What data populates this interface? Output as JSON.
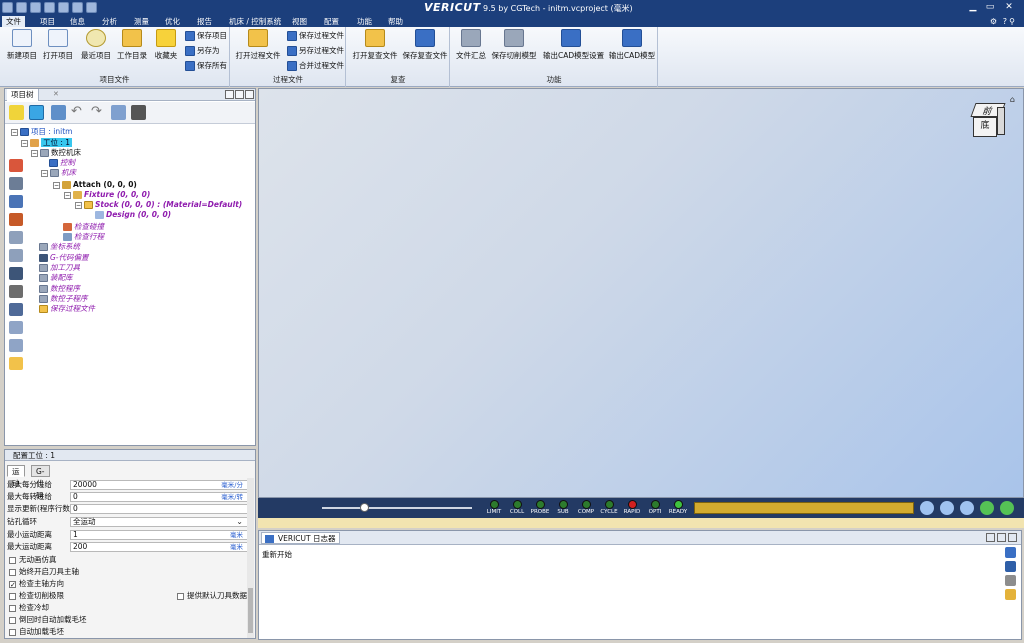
{
  "window": {
    "logo": "VERICUT",
    "title": "9.5 by CGTech - initm.vcproject (毫米)",
    "help": "?"
  },
  "menu": [
    "文件",
    "项目",
    "信息",
    "分析",
    "测量",
    "优化",
    "报告",
    "机床 / 控制系统",
    "视图",
    "配置",
    "功能",
    "帮助"
  ],
  "ribbon": {
    "project": {
      "label": "项目文件",
      "new": "新建项目",
      "open": "打开项目",
      "recent": "最近项目",
      "workdir": "工作目录",
      "fav": "收藏夹",
      "save": "保存项目",
      "saveas": "另存为",
      "saveall": "保存所有"
    },
    "process": {
      "label": "过程文件",
      "open": "打开过程文件",
      "save": "保存过程文件",
      "saveas": "另存过程文件",
      "merge": "合并过程文件"
    },
    "setting": {
      "label": "复查",
      "open": "打开复查文件",
      "save": "保存复查文件"
    },
    "function": {
      "label": "功能",
      "summary": "文件汇总",
      "savecut": "保存切削模型",
      "exportcadset": "输出CAD模型设置",
      "exportcad": "输出CAD模型"
    }
  },
  "tree_panel": {
    "tab": "项目树"
  },
  "tree": {
    "project": "项目 : initm",
    "setup": "工位 : 1",
    "machine": "数控机床",
    "control": "控制",
    "machine2": "机床",
    "attach": "Attach (0, 0, 0)",
    "fixture": "Fixture (0, 0, 0)",
    "stock": "Stock (0, 0, 0) : (Material=Default)",
    "design": "Design (0, 0, 0)",
    "collision": "检查碰撞",
    "travel": "检查行程",
    "coords": "坐标系统",
    "gcode": "G-代码偏置",
    "tools": "加工刀具",
    "assembly": "装配库",
    "ncprog": "数控程序",
    "subprog": "数控子程序",
    "savedproc": "保存过程文件"
  },
  "config": {
    "title": "配置工位 : 1",
    "tabs": [
      "运动",
      "G-代码"
    ],
    "rows": [
      {
        "label": "最大每分进给",
        "value": "20000",
        "unit": "毫米/分"
      },
      {
        "label": "最大每转进给",
        "value": "0",
        "unit": "毫米/转"
      },
      {
        "label": "显示更新(程序行数)",
        "value": "0",
        "unit": ""
      },
      {
        "label": "钻孔循环",
        "value": "全运动",
        "unit": "⌄"
      },
      {
        "label": "最小运动距离",
        "value": "1",
        "unit": "毫米"
      },
      {
        "label": "最大运动距离",
        "value": "200",
        "unit": "毫米"
      }
    ],
    "checks": [
      {
        "label": "无动画仿真",
        "checked": false
      },
      {
        "label": "始终开启刀具主轴",
        "checked": false
      },
      {
        "label": "检查主轴方向",
        "checked": true
      },
      {
        "label": "检查切削极限",
        "checked": false
      },
      {
        "label": "检查冷却",
        "checked": false
      },
      {
        "label": "倒回时自动加载毛坯",
        "checked": false
      },
      {
        "label": "自动加载毛坯",
        "checked": false
      }
    ],
    "check_right": {
      "label": "提供默认刀具数据",
      "checked": false
    }
  },
  "cube": {
    "top": "前",
    "front": "底"
  },
  "anim": {
    "leds": [
      "LIMIT",
      "COLL",
      "PROBE",
      "SUB",
      "COMP",
      "CYCLE",
      "RAPID",
      "OPTI",
      "READY"
    ],
    "slider_fraction": 0.28
  },
  "log": {
    "tab": "VERICUT 日志器",
    "text": "重新开始"
  },
  "colors": {
    "titlebar": "#1c3f7c",
    "anim": "#233a64",
    "progress": "#d2ab2f",
    "led_on": "#2d7b2d",
    "rapid": "#d22020",
    "ready": "#3fc33f"
  }
}
